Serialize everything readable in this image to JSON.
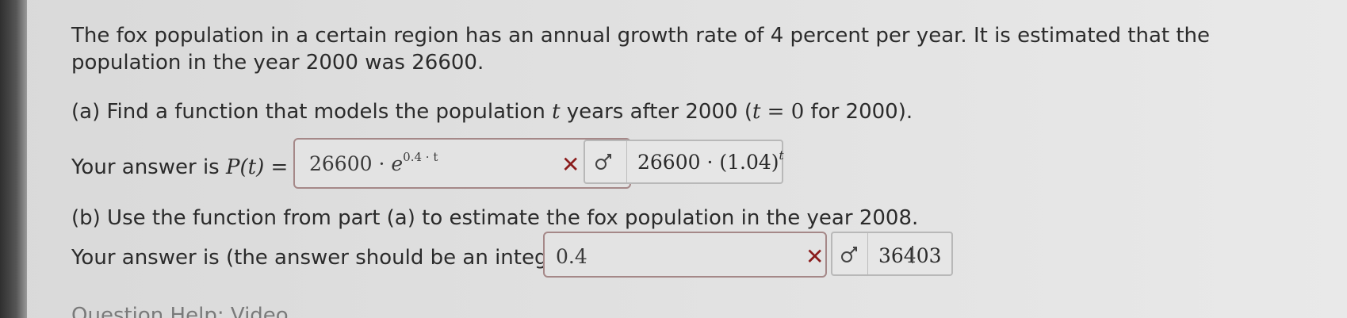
{
  "question": {
    "intro": "The fox population in a certain region has an annual growth rate of 4 percent per year. It is estimated that the population in the year 2000 was 26600."
  },
  "part_a": {
    "prompt_prefix": "(a) Find a function that models the population ",
    "var_t": "t",
    "prompt_mid": " years after 2000 (",
    "equals_zero": " = 0",
    "prompt_suffix": " for 2000).",
    "answer_label": "Your answer is ",
    "function_lhs": "P(t) =",
    "input_value": {
      "base": "26600 · ",
      "e": "e",
      "exponent": "0.4 · t"
    },
    "correct_value": {
      "base": "26600 · (1.04)",
      "exponent": "t"
    },
    "status": "incorrect"
  },
  "part_b": {
    "prompt": "(b) Use the function from part (a) to estimate the fox population in the year 2008.",
    "answer_label": "Your answer is (the answer should be an integer)",
    "input_value": "0.4",
    "correct_value": "36403",
    "status": "incorrect"
  },
  "footer": {
    "partial_text": "Question Help:  Video"
  },
  "icons": {
    "incorrect": "incorrect-x-icon",
    "show_answer": "key-icon"
  },
  "colors": {
    "incorrect_mark": "#8a1b1b",
    "input_border": "#a58888",
    "background": "#e0e0e0"
  }
}
